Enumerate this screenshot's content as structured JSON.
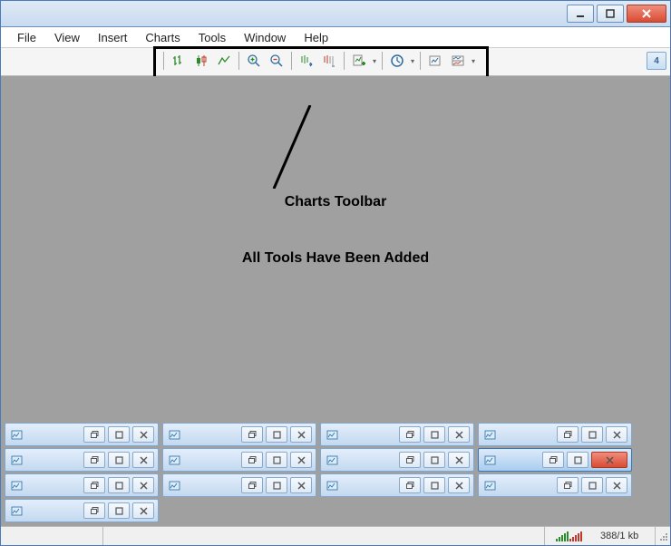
{
  "titlebar": {
    "min_tip": "Minimize",
    "max_tip": "Maximize",
    "close_tip": "Close"
  },
  "menu": {
    "file": "File",
    "view": "View",
    "insert": "Insert",
    "charts": "Charts",
    "tools": "Tools",
    "window": "Window",
    "help": "Help"
  },
  "toolbar": {
    "icons": {
      "bar_chart": "bar-chart-icon",
      "candle": "candlestick-icon",
      "line_chart": "line-chart-icon",
      "zoom_in": "zoom-in-icon",
      "zoom_out": "zoom-out-icon",
      "auto_scroll": "auto-scroll-icon",
      "chart_shift": "chart-shift-icon",
      "indicators": "indicators-icon",
      "periods": "periods-icon",
      "templates": "templates-icon",
      "chart_props": "chart-properties-icon"
    },
    "right_badge": "4"
  },
  "annotations": {
    "label1": "Charts Toolbar",
    "label2": "All Tools Have Been Added"
  },
  "childwindows": {
    "rows": [
      [
        {
          "active": false
        }
      ],
      [
        {
          "active": false
        },
        {
          "active": false
        },
        {
          "active": false
        },
        {
          "active": false
        }
      ],
      [
        {
          "active": false
        },
        {
          "active": false
        },
        {
          "active": false
        },
        {
          "active": true
        }
      ],
      [
        {
          "active": false
        },
        {
          "active": false
        },
        {
          "active": false
        },
        {
          "active": false
        }
      ]
    ]
  },
  "status": {
    "kb": "388/1 kb"
  }
}
